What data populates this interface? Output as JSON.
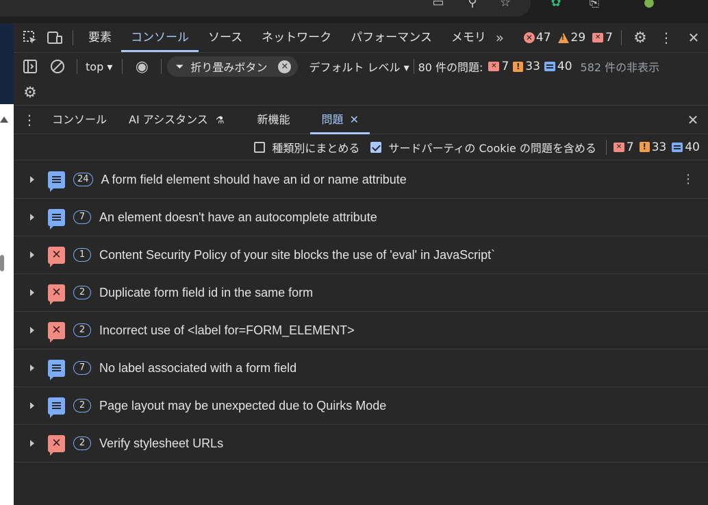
{
  "main_tabs": [
    {
      "label": "要素"
    },
    {
      "label": "コンソール"
    },
    {
      "label": "ソース"
    },
    {
      "label": "ネットワーク"
    },
    {
      "label": "パフォーマンス"
    },
    {
      "label": "メモリ"
    }
  ],
  "counters": {
    "errors": "47",
    "warnings": "29",
    "issues": "7"
  },
  "console_toolbar": {
    "context": "top",
    "filter_value": "折り畳みボタン",
    "level": "デフォルト レベル",
    "issues_label": "80 件の問題:",
    "issue_errors": "7",
    "issue_warnings": "33",
    "issue_info": "40",
    "hidden": "582 件の非表示"
  },
  "drawer_tabs": [
    {
      "label": "コンソール"
    },
    {
      "label": "AI アシスタンス"
    },
    {
      "label": "新機能"
    },
    {
      "label": "問題"
    }
  ],
  "issues_toolbar": {
    "group_by_kind": "種類別にまとめる",
    "third_party": "サードパーティの Cookie の問題を含める",
    "errors": "7",
    "warnings": "33",
    "info": "40"
  },
  "issues": [
    {
      "kind": "info",
      "count": "24",
      "title": "A form field element should have an id or name attribute"
    },
    {
      "kind": "info",
      "count": "7",
      "title": "An element doesn't have an autocomplete attribute"
    },
    {
      "kind": "error",
      "count": "1",
      "title": "Content Security Policy of your site blocks the use of 'eval' in JavaScript`"
    },
    {
      "kind": "error",
      "count": "2",
      "title": "Duplicate form field id in the same form"
    },
    {
      "kind": "error",
      "count": "2",
      "title": "Incorrect use of <label for=FORM_ELEMENT>"
    },
    {
      "kind": "info",
      "count": "7",
      "title": "No label associated with a form field"
    },
    {
      "kind": "info",
      "count": "2",
      "title": "Page layout may be unexpected due to Quirks Mode"
    },
    {
      "kind": "error",
      "count": "2",
      "title": "Verify stylesheet URLs"
    }
  ]
}
